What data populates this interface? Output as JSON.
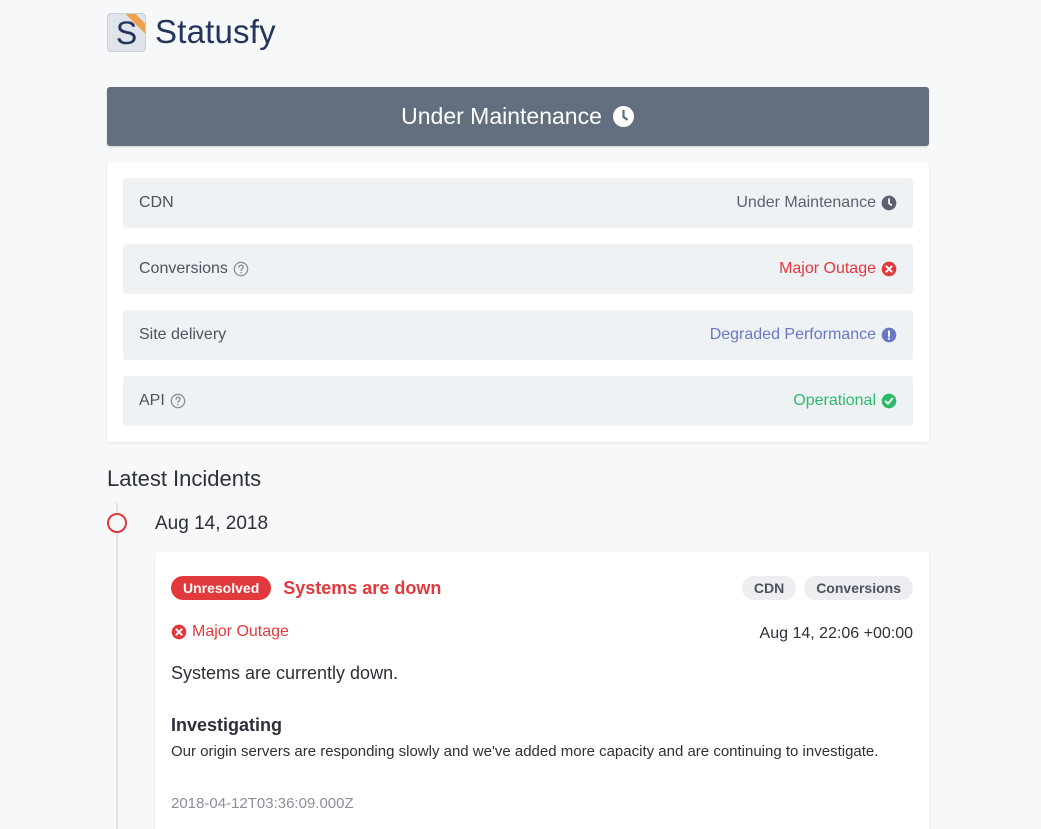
{
  "header": {
    "logo_letter": "S",
    "brand": "Statusfy"
  },
  "banner": {
    "label": "Under Maintenance",
    "icon": "clock-icon"
  },
  "components": [
    {
      "name": "CDN",
      "has_help": false,
      "status": "Under Maintenance",
      "status_icon": "clock-icon",
      "status_color": "#5b6170"
    },
    {
      "name": "Conversions",
      "has_help": true,
      "status": "Major Outage",
      "status_icon": "x-circle-icon",
      "status_color": "#e1393c"
    },
    {
      "name": "Site delivery",
      "has_help": false,
      "status": "Degraded Performance",
      "status_icon": "exclamation-circle-icon",
      "status_color": "#6a78c4"
    },
    {
      "name": "API",
      "has_help": true,
      "status": "Operational",
      "status_icon": "check-circle-icon",
      "status_color": "#2dbb6b"
    }
  ],
  "incidents_section": {
    "title": "Latest Incidents"
  },
  "incident": {
    "date": "Aug 14, 2018",
    "status_badge": "Unresolved",
    "title": "Systems are down",
    "tags": [
      "CDN",
      "Conversions"
    ],
    "impact": "Major Outage",
    "time": "Aug 14, 22:06 +00:00",
    "body": "Systems are currently down.",
    "update": {
      "title": "Investigating",
      "text": "Our origin servers are responding slowly and we've added more capacity and are continuing to investigate.",
      "timestamp": "2018-04-12T03:36:09.000Z"
    }
  },
  "colors": {
    "banner_bg": "#636f7e",
    "major": "#e1393c",
    "degraded": "#6a78c4",
    "operational": "#2dbb6b",
    "maintenance": "#5b6170",
    "brand": "#24355b"
  }
}
